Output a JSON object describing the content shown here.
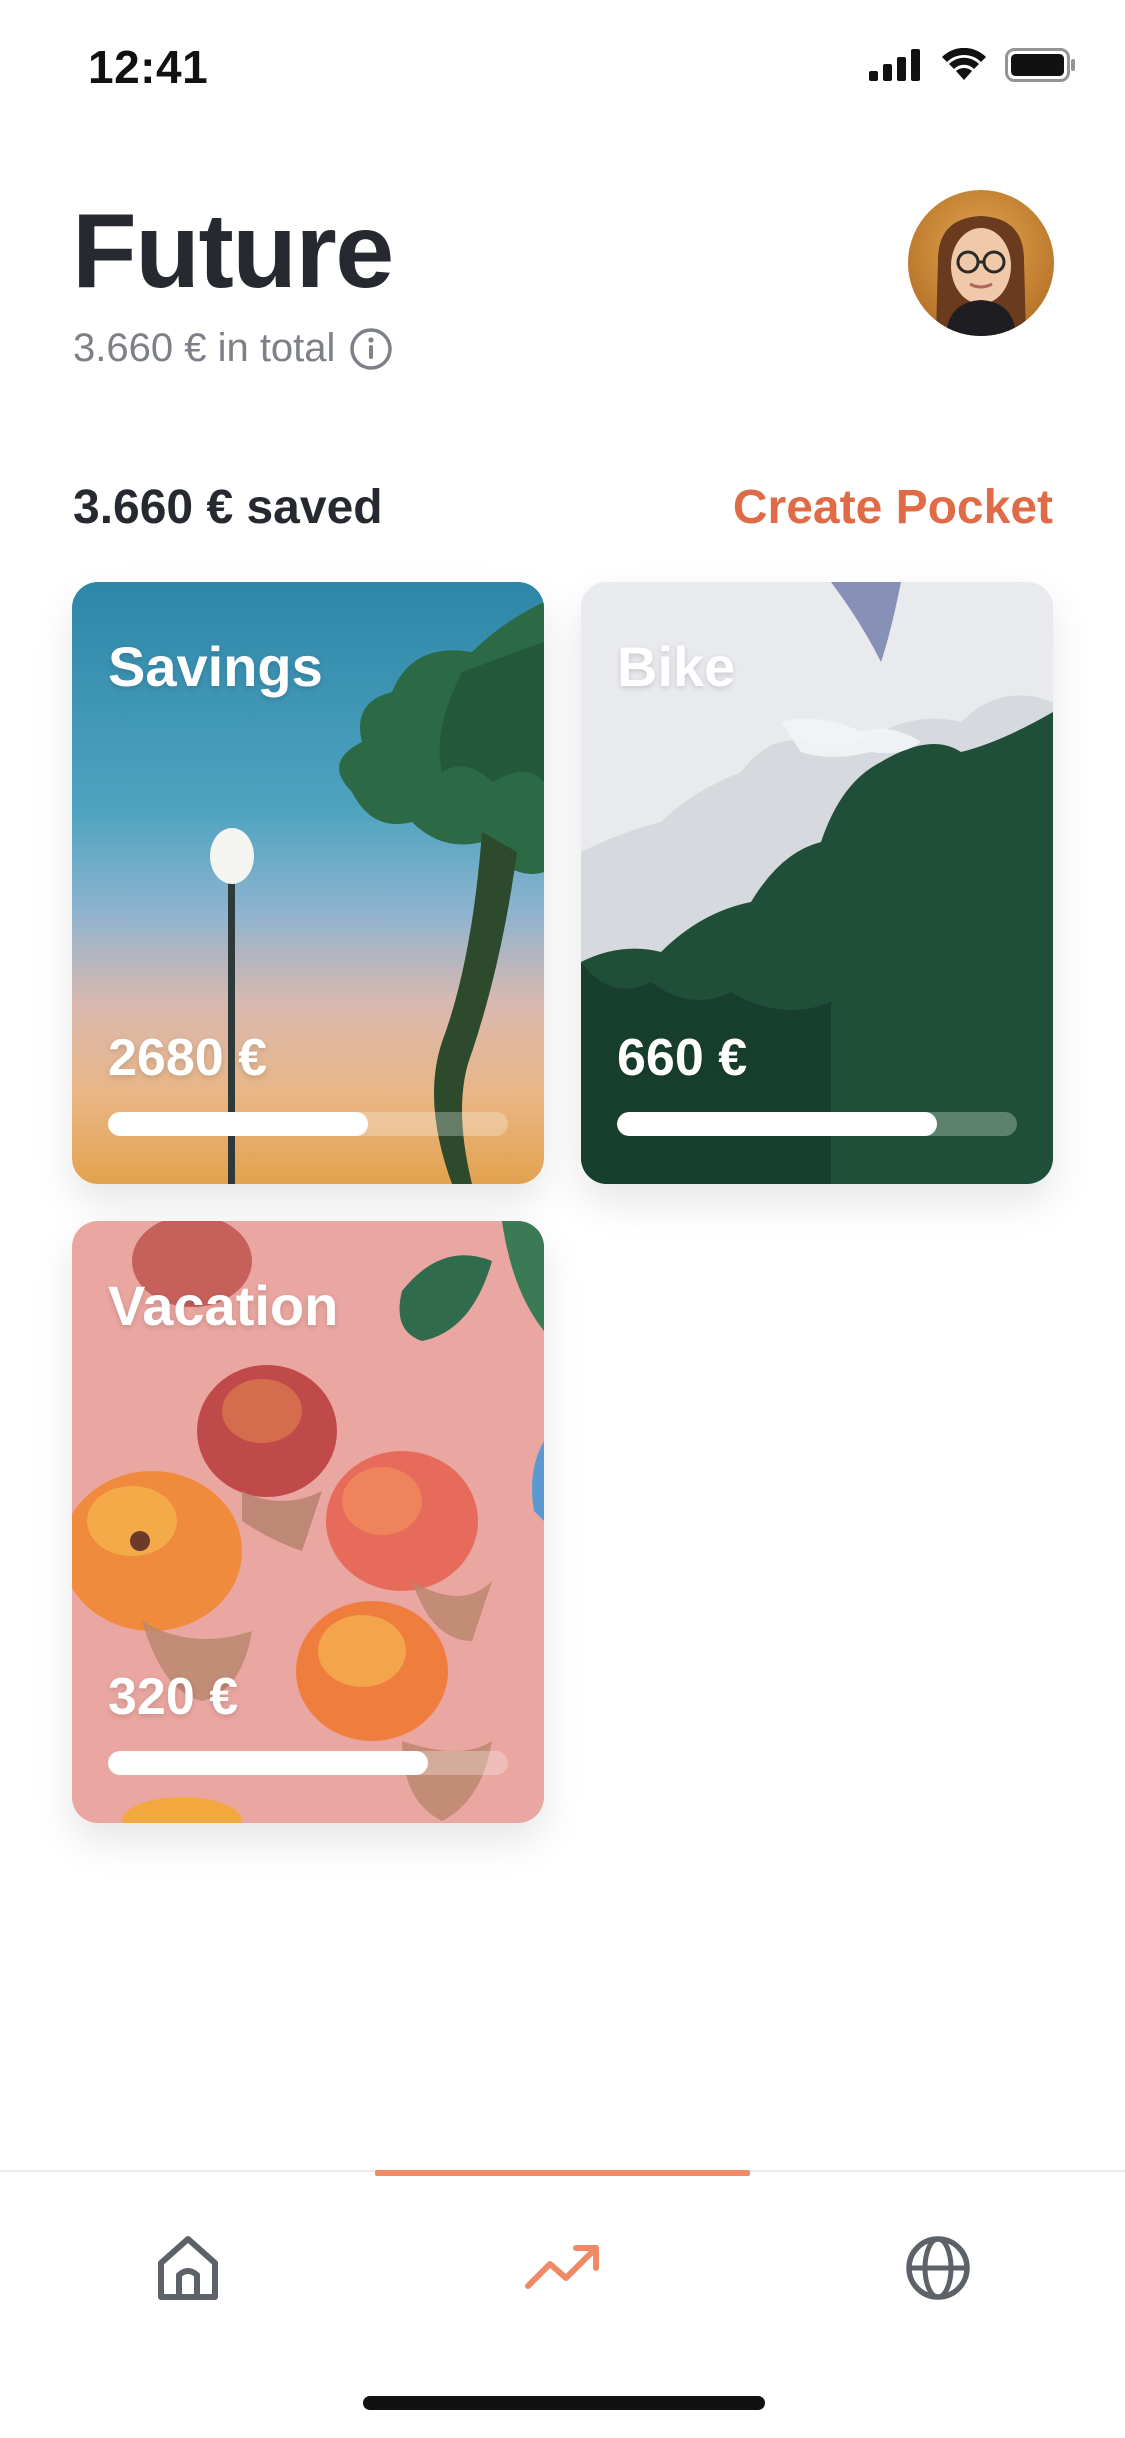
{
  "status_bar": {
    "time": "12:41",
    "icons": [
      "signal-icon",
      "wifi-icon",
      "battery-icon"
    ]
  },
  "header": {
    "title": "Future",
    "total": "3.660 € in total",
    "info_icon": "info-icon",
    "avatar": "avatar"
  },
  "summary": {
    "saved": "3.660 € saved",
    "create_label": "Create Pocket",
    "accent_color": "#e06b47"
  },
  "pockets": [
    {
      "name": "Savings",
      "amount": "2680 €",
      "progress": 0.65
    },
    {
      "name": "Bike",
      "amount": "660 €",
      "progress": 0.8
    },
    {
      "name": "Vacation",
      "amount": "320 €",
      "progress": 0.8
    }
  ],
  "tab_bar": {
    "tabs": [
      {
        "icon": "home-icon",
        "active": false
      },
      {
        "icon": "trending-up-icon",
        "active": true
      },
      {
        "icon": "globe-icon",
        "active": false
      }
    ],
    "active_color": "#f08a66",
    "inactive_color": "#5d6168"
  }
}
